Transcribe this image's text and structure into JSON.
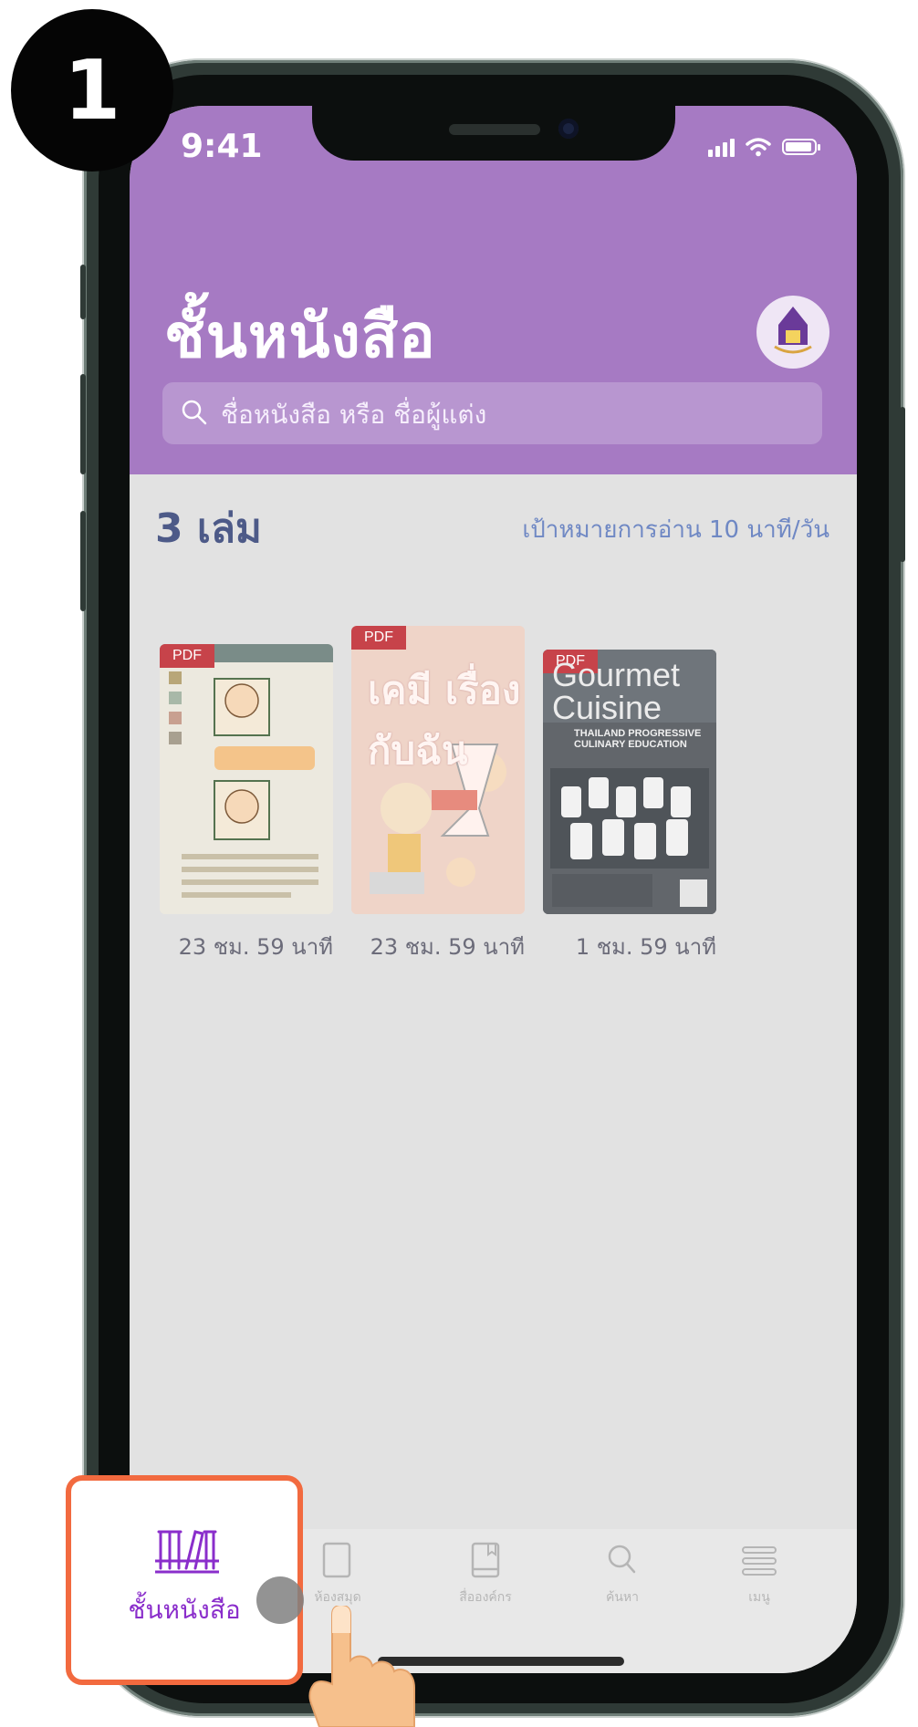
{
  "step_number": "1",
  "status_bar": {
    "time": "9:41"
  },
  "header": {
    "title": "ชั้นหนังสือ",
    "search_placeholder": "ชื่อหนังสือ หรือ ชื่อผู้แต่ง"
  },
  "summary": {
    "count": "3 เล่ม",
    "goal": "เป้าหมายการอ่าน 10 นาที/วัน"
  },
  "books": [
    {
      "badge": "PDF",
      "time_left": "23 ชม. 59 นาที"
    },
    {
      "badge": "PDF",
      "time_left": "23 ชม. 59 นาที",
      "cover_text": "เคมี เรื่อง กับฉัน"
    },
    {
      "badge": "PDF",
      "time_left": "1 ชม. 59 นาที",
      "cover_text": "Gourmet Cuisine",
      "cover_subtitle": "THAILAND PROGRESSIVE CULINARY EDUCATION"
    }
  ],
  "tabbar": {
    "items": [
      {
        "label": "ชั้นหนังสือ",
        "icon": "bookshelf-icon",
        "active": true
      },
      {
        "label": "ห้องสมุด",
        "icon": "library-icon"
      },
      {
        "label": "สื่อองค์กร",
        "icon": "book-icon"
      },
      {
        "label": "ค้นหา",
        "icon": "search-icon"
      },
      {
        "label": "เมนู",
        "icon": "menu-icon"
      }
    ]
  },
  "colors": {
    "header": "#a67ac3",
    "accent": "#8a2ecb",
    "highlight_border": "#f26a3f",
    "pdf_badge": "#c7434a"
  }
}
